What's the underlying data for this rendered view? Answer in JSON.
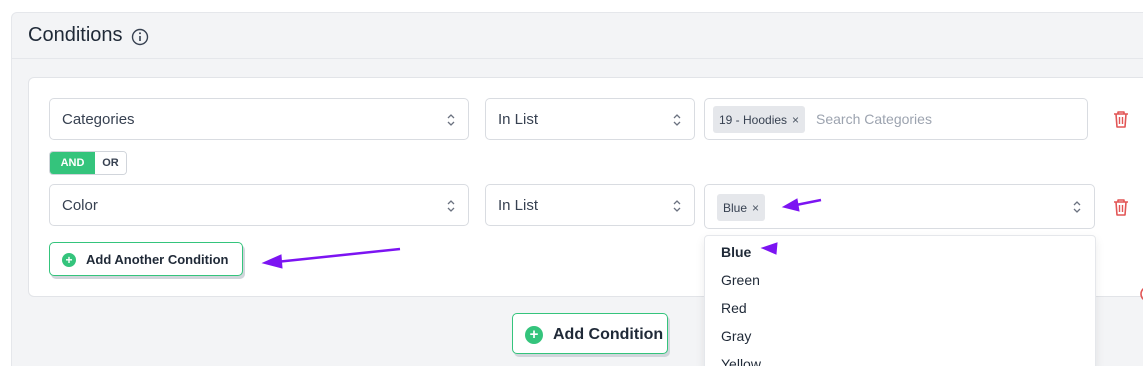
{
  "panel": {
    "title": "Conditions",
    "info_icon": "info-circle-icon"
  },
  "conditions": [
    {
      "field": "Categories",
      "operator": "In List",
      "tags": [
        "19 - Hoodies"
      ],
      "search_placeholder": "Search Categories"
    },
    {
      "field": "Color",
      "operator": "In List",
      "tags": [
        "Blue"
      ]
    }
  ],
  "logic": {
    "and_label": "AND",
    "or_label": "OR",
    "active": "AND"
  },
  "buttons": {
    "add_another": "Add Another Condition",
    "add_condition": "Add Condition"
  },
  "dropdown": {
    "options": [
      "Blue",
      "Green",
      "Red",
      "Gray",
      "Yellow"
    ],
    "selected": "Blue"
  },
  "tag_remove_glyph": "×",
  "colors": {
    "accent": "#34c47c",
    "danger": "#e25555",
    "annotation": "#7c14f2"
  }
}
